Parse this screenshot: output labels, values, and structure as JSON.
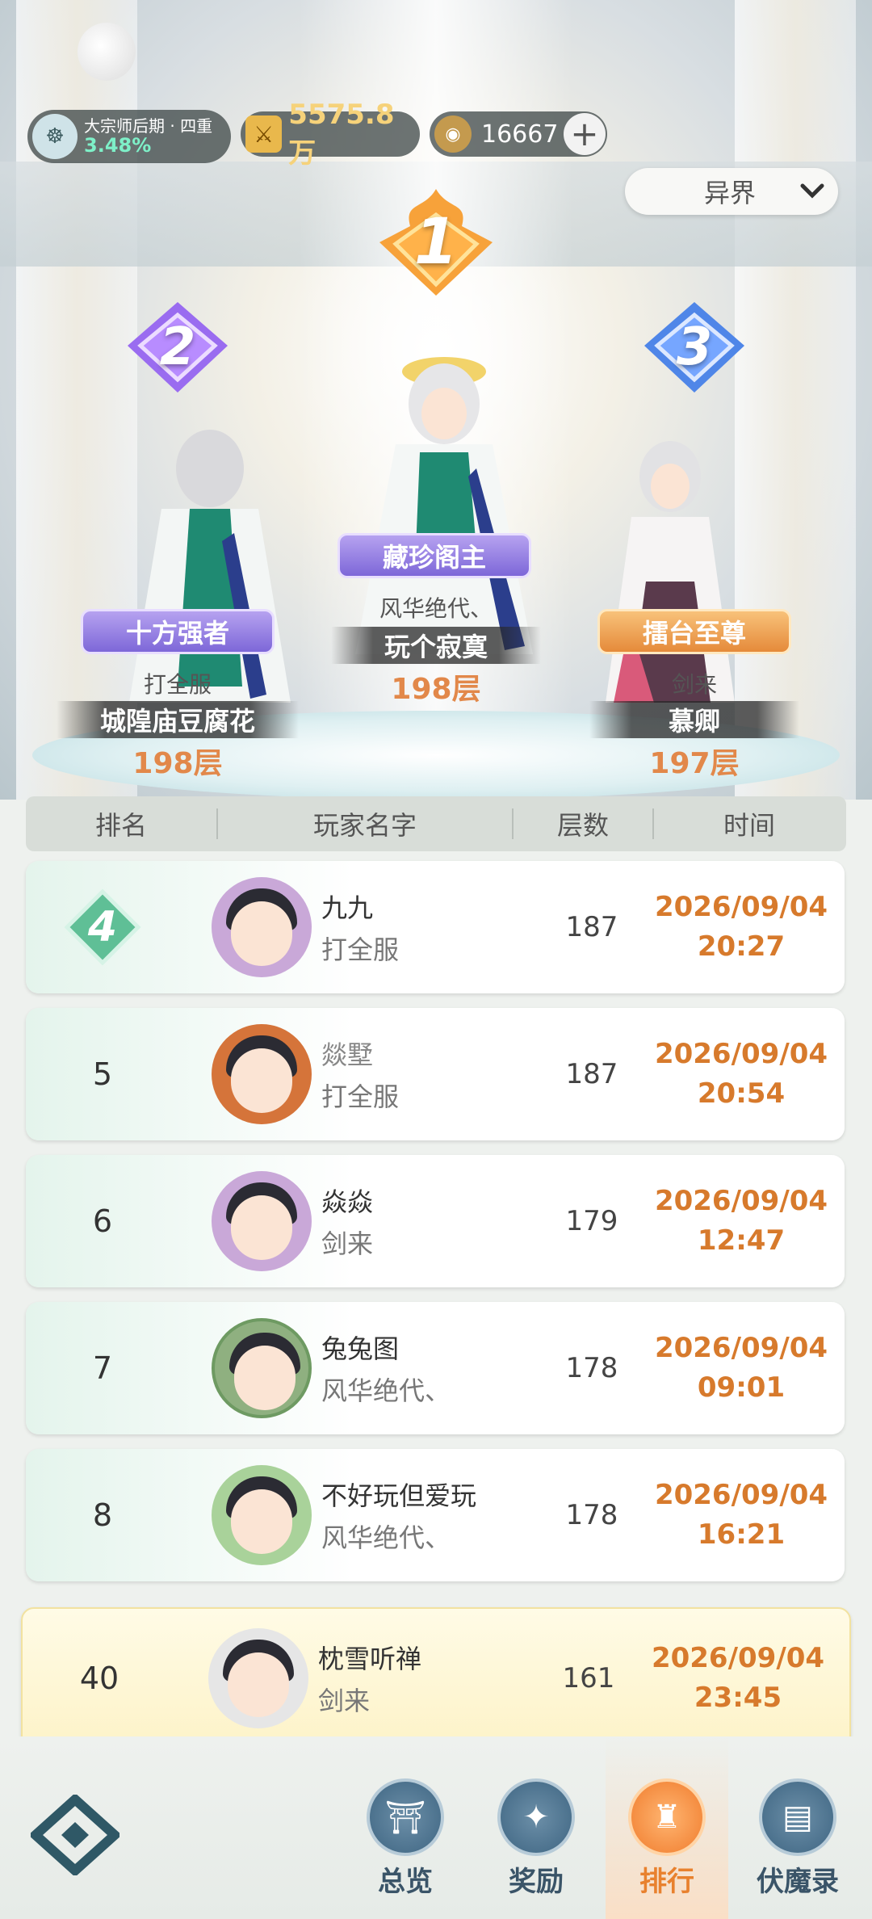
{
  "topbar": {
    "realm_name": "大宗师后期 · 四重",
    "realm_progress": "3.48%",
    "power_value": "5575.8万",
    "coin_value": "16667",
    "plus_label": "+"
  },
  "filter": {
    "selected": "异界"
  },
  "podium": [
    {
      "rank": "1",
      "title": "藏珍阁主",
      "server": "风华绝代、",
      "name": "玩个寂寞",
      "floor": "198层"
    },
    {
      "rank": "2",
      "title": "十方强者",
      "server": "打全服",
      "name": "城隍庙豆腐花",
      "floor": "198层"
    },
    {
      "rank": "3",
      "title": "擂台至尊",
      "server": "剑来",
      "name": "慕卿",
      "floor": "197层"
    }
  ],
  "table": {
    "headers": [
      "排名",
      "玩家名字",
      "层数",
      "时间"
    ],
    "rows": [
      {
        "rank": "4",
        "name": "九九",
        "server": "打全服",
        "layers": "187",
        "date": "2026/09/04",
        "time": "20:27"
      },
      {
        "rank": "5",
        "name": "燚墅",
        "server": "打全服",
        "layers": "187",
        "date": "2026/09/04",
        "time": "20:54"
      },
      {
        "rank": "6",
        "name": "焱焱",
        "server": "剑来",
        "layers": "179",
        "date": "2026/09/04",
        "time": "12:47"
      },
      {
        "rank": "7",
        "name": "兔兔图",
        "server": "风华绝代、",
        "layers": "178",
        "date": "2026/09/04",
        "time": "09:01"
      },
      {
        "rank": "8",
        "name": "不好玩但爱玩",
        "server": "风华绝代、",
        "layers": "178",
        "date": "2026/09/04",
        "time": "16:21"
      }
    ],
    "my_row": {
      "rank": "40",
      "name": "枕雪听禅",
      "server": "剑来",
      "layers": "161",
      "date": "2026/09/04",
      "time": "23:45"
    }
  },
  "nav": {
    "items": [
      {
        "label": "总览",
        "icon": "pagoda-icon"
      },
      {
        "label": "奖励",
        "icon": "gift-icon"
      },
      {
        "label": "排行",
        "icon": "ranking-icon"
      },
      {
        "label": "伏魔录",
        "icon": "scroll-icon"
      }
    ],
    "active": "排行"
  },
  "colors": {
    "accent_orange": "#e58a3a",
    "time_color": "#d77a2c",
    "purple_tag": "#7d67d8",
    "rank4_badge": "#5fbf96"
  }
}
